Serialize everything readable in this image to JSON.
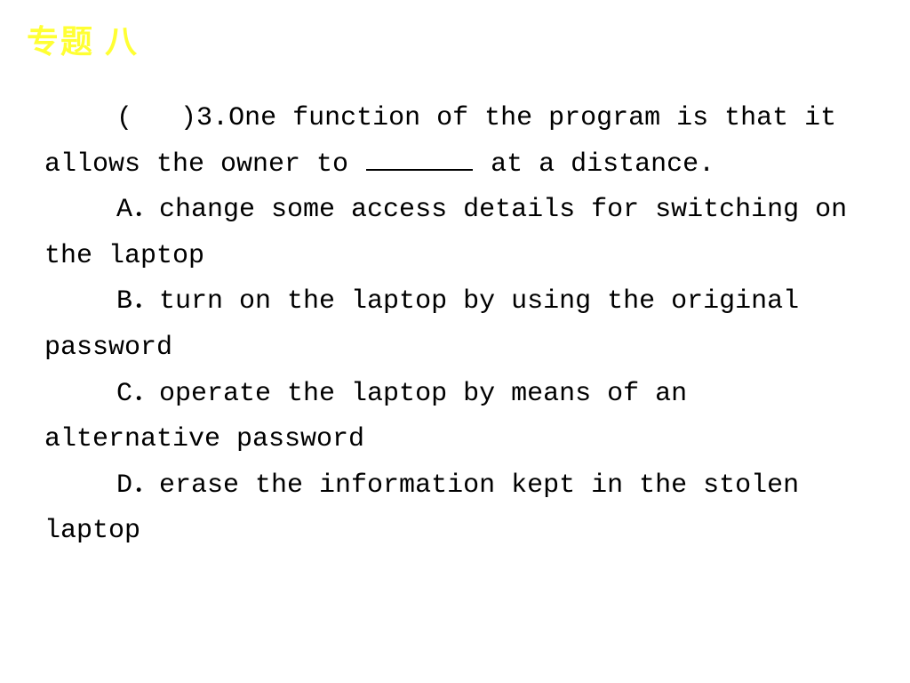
{
  "header": {
    "title": "专题 八"
  },
  "question": {
    "open_paren": "(",
    "close_paren": ")",
    "number": "3.",
    "lead_text": "One function of the program is that it allows the owner to ",
    "tail_text": " at a distance."
  },
  "options": {
    "A": {
      "label": "A．",
      "text": "change some access details for switching on the laptop"
    },
    "B": {
      "label": "B．",
      "text": "turn on the laptop by using the original password"
    },
    "C": {
      "label": "C．",
      "text": "operate the laptop by means of an alternative password"
    },
    "D": {
      "label": "D．",
      "text": "erase the information kept in the stolen laptop"
    }
  }
}
